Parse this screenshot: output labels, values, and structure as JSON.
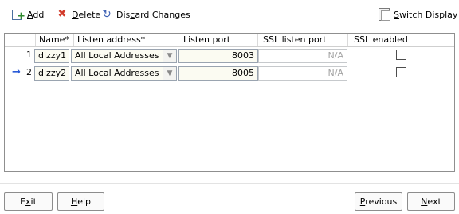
{
  "toolbar": {
    "add": {
      "pre": "",
      "u": "A",
      "post": "dd",
      "icon": "add-row-icon"
    },
    "delete": {
      "pre": "",
      "u": "D",
      "post": "elete",
      "icon": "delete-x-icon"
    },
    "discard": {
      "pre": "Dis",
      "u": "c",
      "post": "ard Changes",
      "icon": "undo-icon"
    },
    "switch": {
      "pre": "",
      "u": "S",
      "post": "witch Display",
      "icon": "switch-display-icon"
    }
  },
  "table": {
    "columns": [
      "Name*",
      "Listen address*",
      "Listen port",
      "SSL listen port",
      "SSL enabled"
    ],
    "rows": [
      {
        "num": "1",
        "name": "dizzy1",
        "address": "All Local Addresses",
        "port": "8003",
        "ssl_port": "N/A",
        "ssl_enabled": false,
        "current": false
      },
      {
        "num": "2",
        "name": "dizzy2",
        "address": "All Local Addresses",
        "port": "8005",
        "ssl_port": "N/A",
        "ssl_enabled": false,
        "current": true
      }
    ]
  },
  "footer": {
    "exit": {
      "pre": "E",
      "u": "x",
      "post": "it"
    },
    "help": {
      "pre": "",
      "u": "H",
      "post": "elp"
    },
    "previous": {
      "pre": "",
      "u": "P",
      "post": "revious"
    },
    "next": {
      "pre": "",
      "u": "N",
      "post": "ext"
    }
  },
  "colors": {
    "arrow": "#2a5bd7",
    "input_bg": "#fbfbf2",
    "delete_icon": "#d23b2b",
    "add_icon": "#2f8a2f"
  }
}
